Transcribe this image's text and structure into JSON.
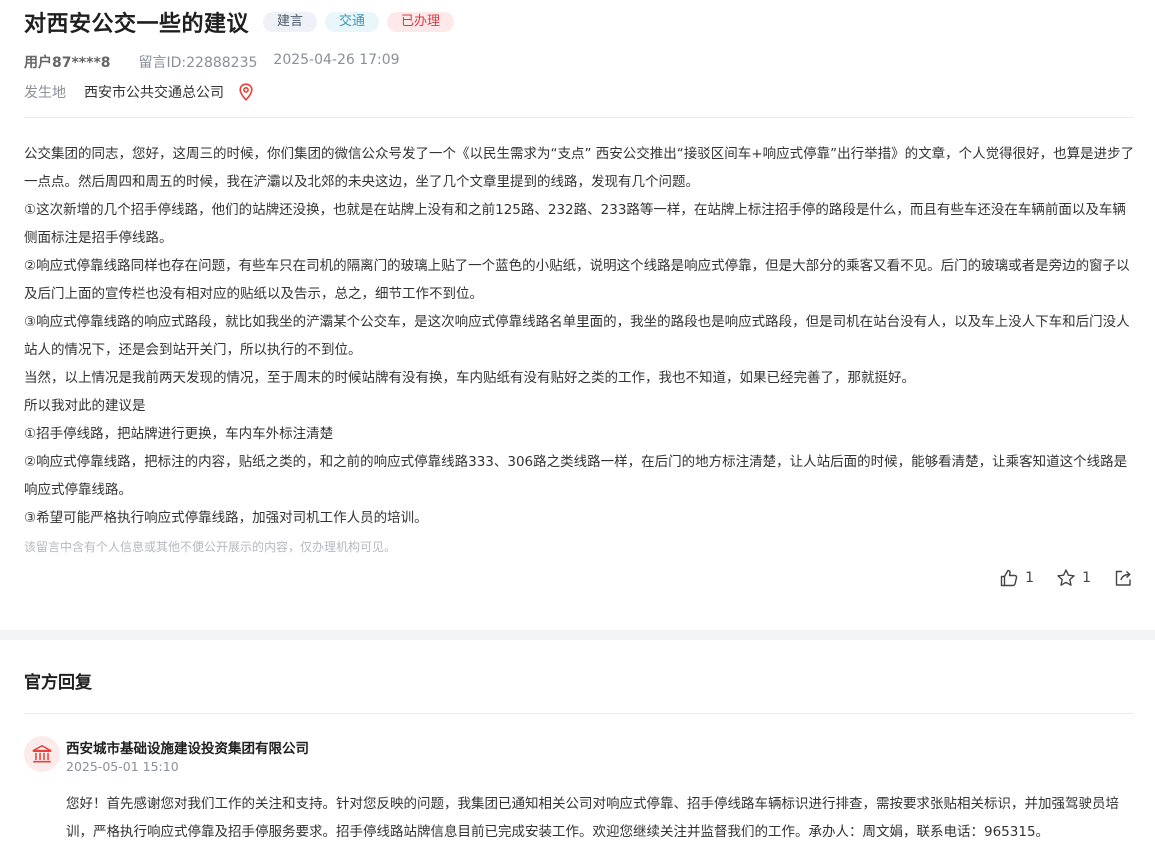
{
  "header": {
    "title": "对西安公交一些的建议",
    "tags": [
      "建言",
      "交通",
      "已办理"
    ]
  },
  "meta": {
    "user": "用户87****8",
    "message_id": "留言ID:22888235",
    "datetime": "2025-04-26 17:09"
  },
  "location": {
    "label": "发生地",
    "value": "西安市公共交通总公司",
    "icon": "location-pin-icon"
  },
  "message": {
    "paragraphs": [
      "公交集团的同志，您好，这周三的时候，你们集团的微信公众号发了一个《以民生需求为“支点” 西安公交推出“接驳区间车+响应式停靠”出行举措》的文章，个人觉得很好，也算是进步了一点点。然后周四和周五的时候，我在浐灞以及北郊的未央这边，坐了几个文章里提到的线路，发现有几个问题。",
      "①这次新增的几个招手停线路，他们的站牌还没换，也就是在站牌上没有和之前125路、232路、233路等一样，在站牌上标注招手停的路段是什么，而且有些车还没在车辆前面以及车辆侧面标注是招手停线路。",
      "②响应式停靠线路同样也存在问题，有些车只在司机的隔离门的玻璃上贴了一个蓝色的小贴纸，说明这个线路是响应式停靠，但是大部分的乘客又看不见。后门的玻璃或者是旁边的窗子以及后门上面的宣传栏也没有相对应的贴纸以及告示，总之，细节工作不到位。",
      "③响应式停靠线路的响应式路段，就比如我坐的浐灞某个公交车，是这次响应式停靠线路名单里面的，我坐的路段也是响应式路段，但是司机在站台没有人，以及车上没人下车和后门没人站人的情况下，还是会到站开关门，所以执行的不到位。",
      "当然，以上情况是我前两天发现的情况，至于周末的时候站牌有没有换，车内贴纸有没有贴好之类的工作，我也不知道，如果已经完善了，那就挺好。",
      "所以我对此的建议是",
      "①招手停线路，把站牌进行更换，车内车外标注清楚",
      "②响应式停靠线路，把标注的内容，贴纸之类的，和之前的响应式停靠线路333、306路之类线路一样，在后门的地方标注清楚，让人站后面的时候，能够看清楚，让乘客知道这个线路是响应式停靠线路。",
      "③希望可能严格执行响应式停靠线路，加强对司机工作人员的培训。"
    ],
    "privacy_notice": "该留言中含有个人信息或其他不便公开展示的内容，仅办理机构可见。"
  },
  "actions": {
    "like_count": "1",
    "favorite_count": "1"
  },
  "reply": {
    "section_title": "官方回复",
    "org_name": "西安城市基础设施建设投资集团有限公司",
    "datetime": "2025-05-01 15:10",
    "body": "您好！首先感谢您对我们工作的关注和支持。针对您反映的问题，我集团已通知相关公司对响应式停靠、招手停线路车辆标识进行排查，需按要求张贴相关标识，并加强驾驶员培训，严格执行响应式停靠及招手停服务要求。招手停线路站牌信息目前已完成安装工作。欢迎您继续关注并监督我们的工作。承办人：周文娟，联系电话：965315。"
  },
  "colors": {
    "accent_red": "#e8413c",
    "tag_done": "#d63c47",
    "tag_traffic": "#3f96b8"
  }
}
